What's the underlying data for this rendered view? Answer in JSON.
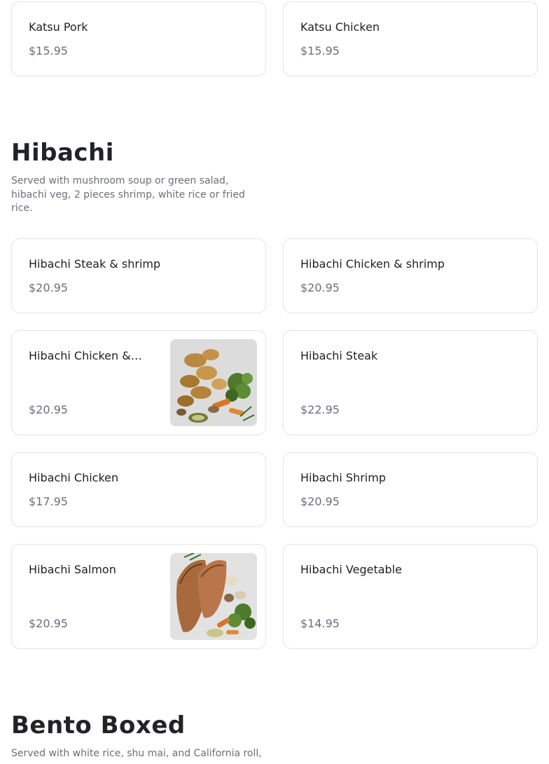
{
  "katsu": {
    "items": [
      {
        "name": "Katsu Pork",
        "price": "$15.95"
      },
      {
        "name": "Katsu Chicken",
        "price": "$15.95"
      }
    ]
  },
  "hibachi": {
    "title": "Hibachi",
    "description": "Served with mushroom soup or green salad, hibachi veg, 2 pieces shrimp, white rice or fried rice.",
    "items": [
      {
        "name": "Hibachi Steak & shrimp",
        "price": "$20.95"
      },
      {
        "name": "Hibachi Chicken & shrimp",
        "price": "$20.95"
      },
      {
        "name": "Hibachi Chicken & Steak",
        "price": "$20.95",
        "image": "hibachi-chicken-photo"
      },
      {
        "name": "Hibachi Steak",
        "price": "$22.95"
      },
      {
        "name": "Hibachi Chicken",
        "price": "$17.95"
      },
      {
        "name": "Hibachi Shrimp",
        "price": "$20.95"
      },
      {
        "name": "Hibachi Salmon",
        "price": "$20.95",
        "image": "hibachi-salmon-photo"
      },
      {
        "name": "Hibachi Vegetable",
        "price": "$14.95"
      }
    ]
  },
  "bento": {
    "title": "Bento Boxed",
    "description": "Served with white rice, shu mai, and California roll,"
  }
}
